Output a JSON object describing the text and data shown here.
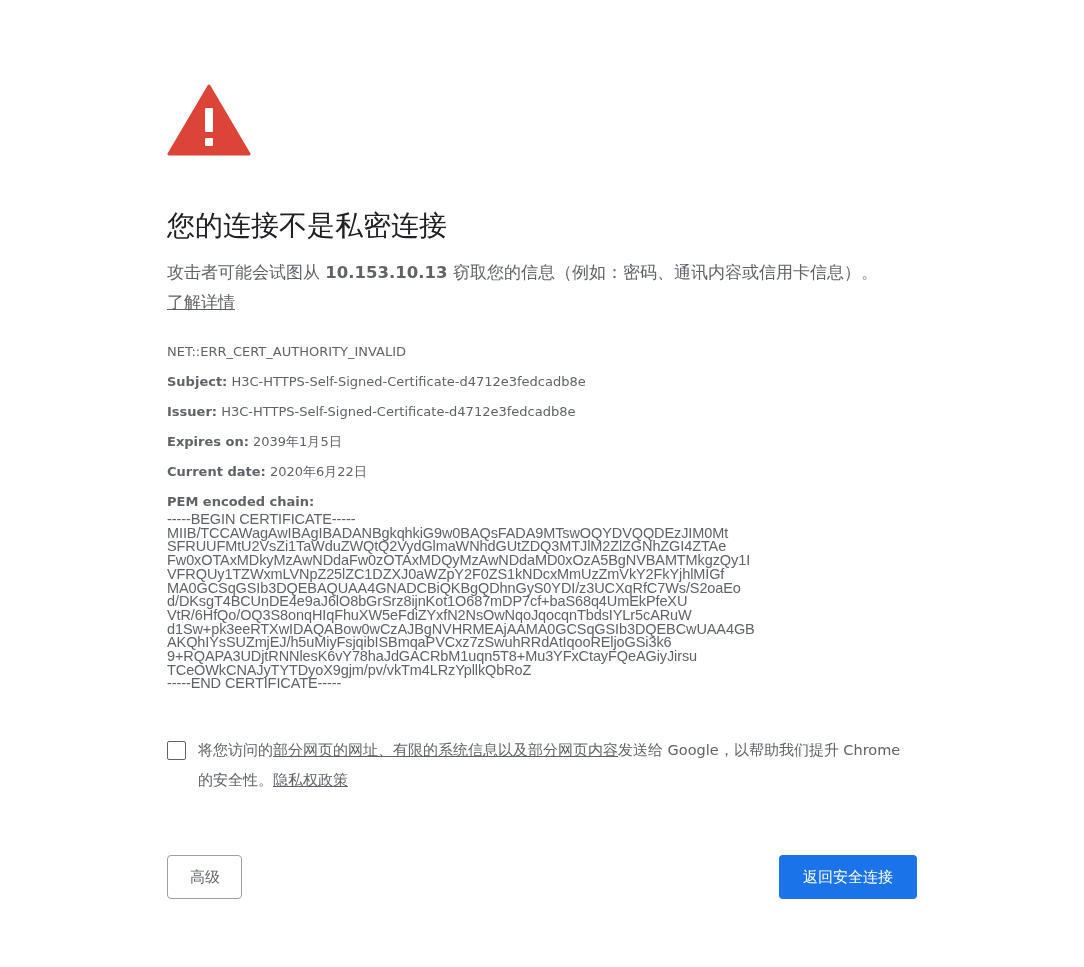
{
  "heading": "您的连接不是私密连接",
  "message": {
    "text": "攻击者可能会试图从 **10.153.10.13** 窃取您的信息（例如：密码、通讯内容或信用卡信息）。",
    "link": "了解详情"
  },
  "error_code": "NET::ERR_CERT_AUTHORITY_INVALID",
  "details": [
    "**Subject:** H3C-HTTPS-Self-Signed-Certificate-d4712e3fedcadb8e",
    "**Issuer:** H3C-HTTPS-Self-Signed-Certificate-d4712e3fedcadb8e",
    "**Expires on:** 2039年1月5日",
    "**Current date:** 2020年6月22日"
  ],
  "pem_label": "PEM encoded chain:",
  "pem_lines": [
    "-----BEGIN CERTIFICATE-----",
    "MIIB/TCCAWagAwIBAgIBADANBgkqhkiG9w0BAQsFADA9MTswOQYDVQQDEzJIM0Mt",
    "SFRUUFMtU2VsZi1TaWduZWQtQ2VydGlmaWNhdGUtZDQ3MTJlM2ZlZGNhZGI4ZTAe",
    "Fw0xOTAxMDkyMzAwNDdaFw0zOTAxMDQyMzAwNDdaMD0xOzA5BgNVBAMTMkgzQy1I",
    "VFRQUy1TZWxmLVNpZ25lZC1DZXJ0aWZpY2F0ZS1kNDcxMmUzZmVkY2FkYjhlMIGf",
    "MA0GCSqGSIb3DQEBAQUAA4GNADCBiQKBgQDhnGyS0YDI/z3UCXqRfC7Ws/S2oaEo",
    "d/DKsgT4BCUnDE4e9aJ6lO8bGrSrz8ijnKot1O687mDP7cf+baS68q4UmEkPfeXU",
    "VtR/6HfQo/OQ3S8onqHIqFhuXW5eFdiZYxfN2NsOwNqoJqocqnTbdsIYLr5cARuW",
    "d1Sw+pk3eeRTXwIDAQABow0wCzAJBgNVHRMEAjAAMA0GCSqGSIb3DQEBCwUAA4GB",
    "AKQhIYsSUZmjEJ/h5uMiyFsjqibISBmqaPVCxz7zSwuhRRdAtIqooREljoGSi3k6",
    "9+RQAPA3UDjtRNNlesK6vY78haJdGACRbM1uqn5T8+Mu3YFxCtayFQeAGiyJirsu",
    "TCeOWkCNAJyTYTDyoX9gjm/pv/vkTm4LRzYpllkQbRoZ",
    "-----END CERTIFICATE-----"
  ],
  "report": {
    "checked": false,
    "before": "将您访问的",
    "link": "部分网页的网址、有限的系统信息以及部分网页内容",
    "after": "发送给 Google，以帮助我们提升 Chrome 的安全性。",
    "privacy_link": "隐私权政策"
  },
  "buttons": {
    "advanced": "高级",
    "back": "返回安全连接"
  }
}
